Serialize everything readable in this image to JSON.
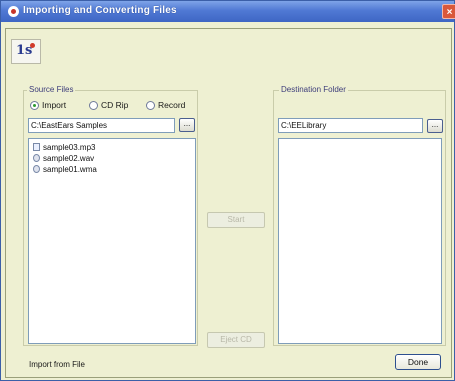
{
  "window": {
    "title": "Importing and Converting Files",
    "close_glyph": "×"
  },
  "logo": {
    "text": "1s"
  },
  "source": {
    "group_label": "Source Files",
    "modes": [
      {
        "label": "Import",
        "selected": true
      },
      {
        "label": "CD Rip",
        "selected": false
      },
      {
        "label": "Record",
        "selected": false
      }
    ],
    "path": "C:\\EastEars Samples",
    "browse_label": "...",
    "files": [
      {
        "name": "sample03.mp3",
        "icon": "mp3-file-icon"
      },
      {
        "name": "sample02.wav",
        "icon": "wav-file-icon"
      },
      {
        "name": "sample01.wma",
        "icon": "wma-file-icon"
      }
    ]
  },
  "destination": {
    "group_label": "Destination Folder",
    "path": "C:\\EELibrary",
    "browse_label": "..."
  },
  "actions": {
    "start_label": "Start",
    "eject_label": "Eject CD",
    "done_label": "Done"
  },
  "status": {
    "text": "Import from File"
  }
}
